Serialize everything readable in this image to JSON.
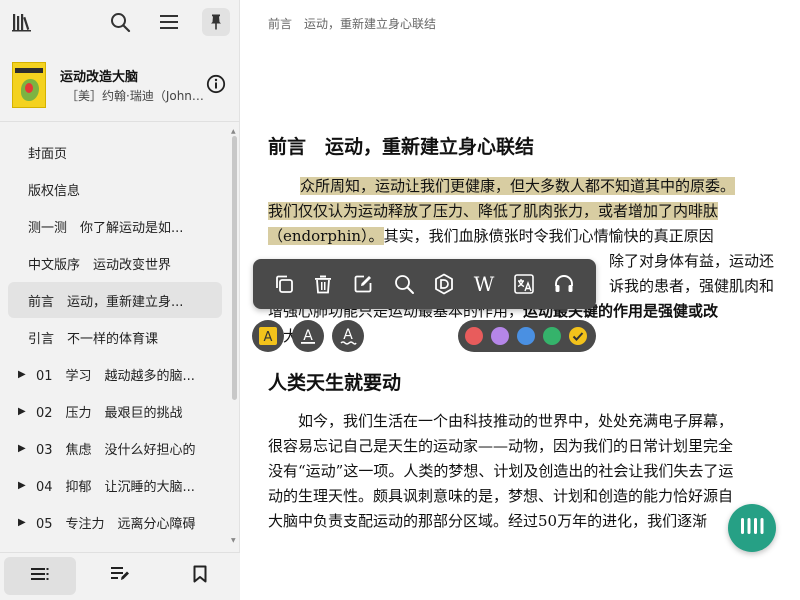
{
  "book": {
    "title": "运动改造大脑",
    "author": "［美］约翰·瑞迪（John R..."
  },
  "toc": [
    {
      "label": "封面页",
      "expandable": false,
      "active": false
    },
    {
      "label": "版权信息",
      "expandable": false,
      "active": false
    },
    {
      "label": "测一测　你了解运动是如...",
      "expandable": false,
      "active": false
    },
    {
      "label": "中文版序　运动改变世界",
      "expandable": false,
      "active": false
    },
    {
      "label": "前言　运动，重新建立身...",
      "expandable": false,
      "active": true
    },
    {
      "label": "引言　不一样的体育课",
      "expandable": false,
      "active": false
    },
    {
      "label": "01　学习　越动越多的脑...",
      "expandable": true,
      "active": false
    },
    {
      "label": "02　压力　最艰巨的挑战",
      "expandable": true,
      "active": false
    },
    {
      "label": "03　焦虑　没什么好担心的",
      "expandable": true,
      "active": false
    },
    {
      "label": "04　抑郁　让沉睡的大脑...",
      "expandable": true,
      "active": false
    },
    {
      "label": "05　专注力　远离分心障碍",
      "expandable": true,
      "active": false
    }
  ],
  "breadcrumb": "前言　运动，重新建立身心联结",
  "chapter_title": "前言　运动，重新建立身心联结",
  "paragraph1": {
    "l1_hl": "众所周知，运动让我们更健康，但大多数人都不知道其中的原委。",
    "l2_hl": "我们仅仅认为运动释放了压力、降低了肌肉张力，或者增加了内啡肽",
    "l3_hl": "（endorphin）。",
    "l3_rest": "其实，我们血脉偾张时令我们心情愉快的真正原因",
    "l4_end": "除了对身体有益，运动还",
    "l5_end": "诉我的患者，强健肌肉和",
    "l6_start": "增强心肺功能只是运动最基本的作用，",
    "l6_bold": "运动最关键的作用是强健或改",
    "l7_start": "善大"
  },
  "section_title": "人类天生就要动",
  "paragraph2": [
    "　　如今，我们生活在一个由科技推动的世界中，处处充满电子屏幕，",
    "很容易忘记自己是天生的运动家——动物，因为我们的日常计划里完全",
    "没有“运动”这一项。人类的梦想、计划及创造出的社会让我们失去了运",
    "动的生理天性。颇具讽刺意味的是，梦想、计划和创造的能力恰好源自",
    "大脑中负责支配运动的那部分区域。经过50万年的进化，我们逐渐"
  ],
  "toolbar": {
    "dictionary_label": "W"
  },
  "highlight_colors": [
    "#e85c5c",
    "#b586e8",
    "#4a90e2",
    "#35b36b",
    "#f2c21b"
  ],
  "accent": "#26a085"
}
